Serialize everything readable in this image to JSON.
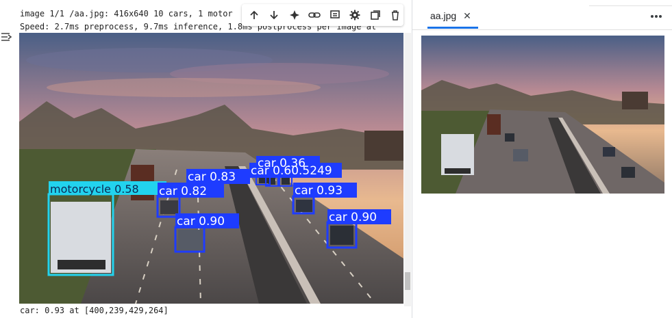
{
  "output": {
    "line1": "image 1/1 /aa.jpg: 416x640 10 cars, 1 motor",
    "line2": "Speed: 2.7ms preprocess, 9.7ms inference, 1.8ms postprocess per image at",
    "line3": "car: 0.93 at [400,239,429,264]"
  },
  "toolbar": {
    "items": [
      "arrow-up-icon",
      "arrow-down-icon",
      "sparkle-icon",
      "link-icon",
      "comment-icon",
      "gear-icon",
      "mirror-cell-icon",
      "delete-icon"
    ]
  },
  "detections": [
    {
      "label": "motorcycle 0.58",
      "color": "#22d3ee"
    },
    {
      "label": "car 0.83",
      "color": "#1e3cff"
    },
    {
      "label": "car 0.82",
      "color": "#1e3cff"
    },
    {
      "label": "car 0.90",
      "color": "#1e3cff"
    },
    {
      "label": "car 0.36",
      "color": "#1e3cff"
    },
    {
      "label": "car 0.60.5249",
      "color": "#1e3cff"
    },
    {
      "label": "car 0.93",
      "color": "#1e3cff"
    },
    {
      "label": "car 0.90",
      "color": "#1e3cff"
    }
  ],
  "viewer": {
    "tab_title": "aa.jpg",
    "close_glyph": "✕",
    "more_glyph": "⋮"
  },
  "colors": {
    "tab_accent": "#1a73e8",
    "person_box": "#22d3ee",
    "car_box": "#1e3cff"
  }
}
